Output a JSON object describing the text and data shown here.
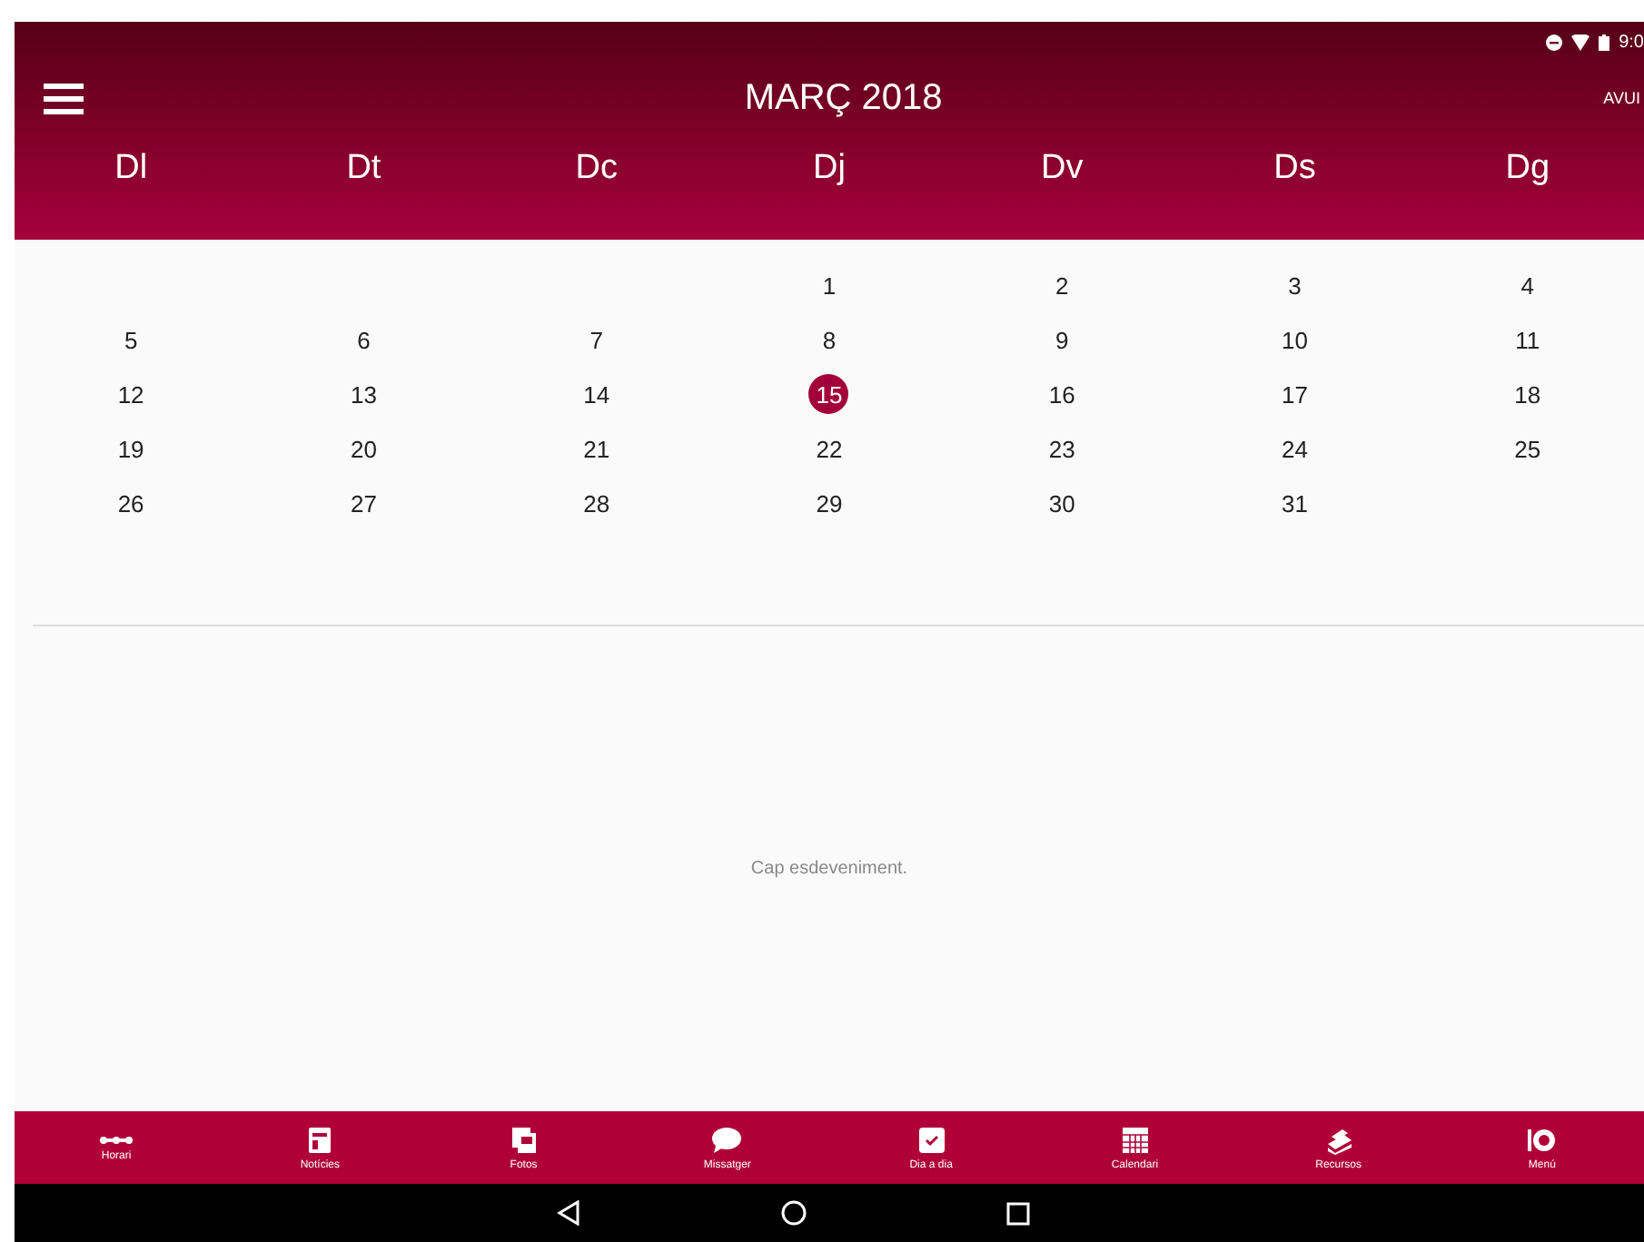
{
  "status_bar": {
    "time": "9:0"
  },
  "app_bar": {
    "title": "MARÇ 2018",
    "action": "AVUI"
  },
  "weekdays": [
    "Dl",
    "Dt",
    "Dc",
    "Dj",
    "Dv",
    "Ds",
    "Dg"
  ],
  "weeks": [
    {
      "kind": "trailing",
      "days": [
        {
          "label": "1",
          "selected": false
        },
        {
          "label": "2",
          "selected": false
        },
        {
          "label": "3",
          "selected": false
        },
        {
          "label": "4",
          "selected": false
        }
      ]
    },
    {
      "kind": "full",
      "days": [
        {
          "label": "5",
          "selected": false
        },
        {
          "label": "6",
          "selected": false
        },
        {
          "label": "7",
          "selected": false
        },
        {
          "label": "8",
          "selected": false
        },
        {
          "label": "9",
          "selected": false
        },
        {
          "label": "10",
          "selected": false
        },
        {
          "label": "11",
          "selected": false
        }
      ]
    },
    {
      "kind": "full",
      "days": [
        {
          "label": "12",
          "selected": false
        },
        {
          "label": "13",
          "selected": false
        },
        {
          "label": "14",
          "selected": false
        },
        {
          "label": "15",
          "selected": true
        },
        {
          "label": "16",
          "selected": false
        },
        {
          "label": "17",
          "selected": false
        },
        {
          "label": "18",
          "selected": false
        }
      ]
    },
    {
      "kind": "full",
      "days": [
        {
          "label": "19",
          "selected": false
        },
        {
          "label": "20",
          "selected": false
        },
        {
          "label": "21",
          "selected": false
        },
        {
          "label": "22",
          "selected": false
        },
        {
          "label": "23",
          "selected": false
        },
        {
          "label": "24",
          "selected": false
        },
        {
          "label": "25",
          "selected": false
        }
      ]
    },
    {
      "kind": "leading",
      "days": [
        {
          "label": "26",
          "selected": false
        },
        {
          "label": "27",
          "selected": false
        },
        {
          "label": "28",
          "selected": false
        },
        {
          "label": "29",
          "selected": false
        },
        {
          "label": "30",
          "selected": false
        },
        {
          "label": "31",
          "selected": false
        }
      ]
    }
  ],
  "events": {
    "empty_message": "Cap esdeveniment."
  },
  "bottom_nav": [
    {
      "label": "Horari"
    },
    {
      "label": "Notícies"
    },
    {
      "label": "Fotos"
    },
    {
      "label": "Missatger"
    },
    {
      "label": "Dia a dia"
    },
    {
      "label": "Calendari"
    },
    {
      "label": "Recursos"
    },
    {
      "label": "Menú"
    }
  ]
}
